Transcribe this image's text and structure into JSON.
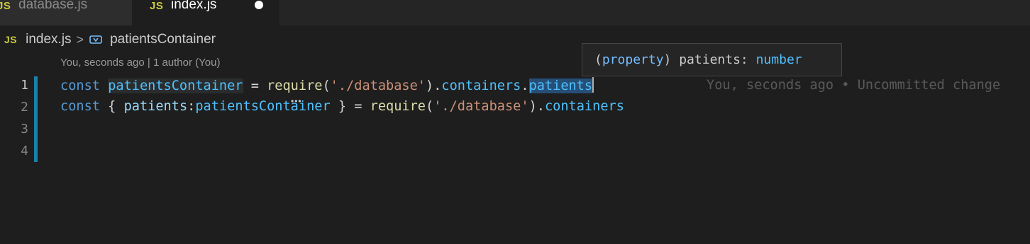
{
  "tabs": [
    {
      "badge": "JS",
      "label": "database.js",
      "active": false
    },
    {
      "badge": "JS",
      "label": "index.js",
      "active": true,
      "dirty": true
    }
  ],
  "breadcrumb": {
    "badge": "JS",
    "file": "index.js",
    "separator": ">",
    "symbol_icon": "symbol-variable-icon",
    "symbol": "patientsContainer"
  },
  "codelens": "You, seconds ago | 1 author (You)",
  "hover": {
    "prefix": "(",
    "keyword": "property",
    "suffix": ") patients: ",
    "type": "number"
  },
  "editor": {
    "line_numbers": [
      "1",
      "2",
      "3",
      "4"
    ],
    "active_line": "1",
    "line1": {
      "kw": "const",
      "var": "patientsContainer",
      "eq": " = ",
      "fn": "require",
      "open": "(",
      "str": "'./database'",
      "close": ").",
      "prop1": "containers",
      "dot": ".",
      "prop2": "patients"
    },
    "line2": {
      "kw": "const",
      "brace_open": " { ",
      "prop": "patients",
      "colon": ":",
      "var": "patientsContainer",
      "brace_close": " } = ",
      "fn": "require",
      "open": "(",
      "str": "'./database'",
      "close": ").",
      "prop1": "containers"
    },
    "blame": "You, seconds ago • Uncommitted change"
  },
  "colors": {
    "background": "#1e1e1e",
    "keyword": "#569cd6",
    "string": "#ce9178",
    "function": "#dcdcaa",
    "variable": "#4fc1ff",
    "js_badge": "#cbcb41",
    "modified_bar": "#1b81a8"
  }
}
